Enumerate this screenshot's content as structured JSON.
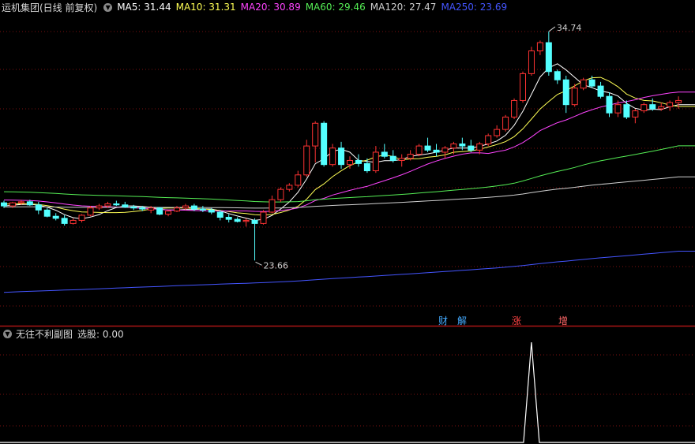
{
  "header": {
    "title": "运机集团(日线 前复权)",
    "ma": [
      {
        "label": "MA5: 31.44",
        "color": "#ffffff"
      },
      {
        "label": "MA10: 31.31",
        "color": "#ffff55"
      },
      {
        "label": "MA20: 30.89",
        "color": "#ff44ff"
      },
      {
        "label": "MA60: 29.46",
        "color": "#55ee55"
      },
      {
        "label": "MA120: 27.47",
        "color": "#d0d0d0"
      },
      {
        "label": "MA250: 23.69",
        "color": "#4455ff"
      }
    ]
  },
  "indicator": {
    "title": "无往不利副图",
    "value_text": "选股: 0.00"
  },
  "annotations": {
    "high": "34.74",
    "low": "23.66",
    "events": [
      {
        "text": "财",
        "color": "#44aaff"
      },
      {
        "text": "解",
        "color": "#44aaff"
      },
      {
        "text": "涨",
        "color": "#ff4444"
      },
      {
        "text": "增",
        "color": "#ff6666"
      }
    ]
  },
  "colors": {
    "up": "#ff3333",
    "down": "#54ffff",
    "grid": "#7a1010",
    "separator": "#aa1515",
    "ma5": "#ffffff",
    "ma10": "#ffff55",
    "ma20": "#ff44ff",
    "ma60": "#55ee55",
    "ma120": "#d0d0d0",
    "ma250": "#4455ff"
  },
  "chart_data": {
    "type": "candlestick",
    "ohlc": [
      [
        26.45,
        26.55,
        26.2,
        26.3
      ],
      [
        26.3,
        26.5,
        26.2,
        26.45
      ],
      [
        26.45,
        26.6,
        26.35,
        26.5
      ],
      [
        26.5,
        26.6,
        26.3,
        26.35
      ],
      [
        26.35,
        26.5,
        25.9,
        26.1
      ],
      [
        26.1,
        26.2,
        25.75,
        25.8
      ],
      [
        25.8,
        25.95,
        25.6,
        25.7
      ],
      [
        25.7,
        25.85,
        25.35,
        25.45
      ],
      [
        25.45,
        25.7,
        25.4,
        25.6
      ],
      [
        25.6,
        25.9,
        25.5,
        25.85
      ],
      [
        25.85,
        26.3,
        25.8,
        26.2
      ],
      [
        26.2,
        26.4,
        26.1,
        26.3
      ],
      [
        26.3,
        26.5,
        26.2,
        26.4
      ],
      [
        26.4,
        26.55,
        26.3,
        26.35
      ],
      [
        26.35,
        26.5,
        26.2,
        26.25
      ],
      [
        26.25,
        26.35,
        26.1,
        26.2
      ],
      [
        26.2,
        26.3,
        26.05,
        26.15
      ],
      [
        26.1,
        26.3,
        25.95,
        26.2
      ],
      [
        26.2,
        26.25,
        25.85,
        25.9
      ],
      [
        25.9,
        26.1,
        25.8,
        26.05
      ],
      [
        26.05,
        26.3,
        26.0,
        26.2
      ],
      [
        26.2,
        26.4,
        26.1,
        26.3
      ],
      [
        26.3,
        26.4,
        26.05,
        26.15
      ],
      [
        26.15,
        26.3,
        26.0,
        26.1
      ],
      [
        26.1,
        26.2,
        25.9,
        26.0
      ],
      [
        26.0,
        26.1,
        25.6,
        25.75
      ],
      [
        25.75,
        25.9,
        25.5,
        25.65
      ],
      [
        25.65,
        25.75,
        25.5,
        25.55
      ],
      [
        25.55,
        25.7,
        25.3,
        25.6
      ],
      [
        25.6,
        25.7,
        23.66,
        25.45
      ],
      [
        25.45,
        26.1,
        25.4,
        26.0
      ],
      [
        26.0,
        26.8,
        25.95,
        26.6
      ],
      [
        26.6,
        27.2,
        26.5,
        27.1
      ],
      [
        27.1,
        27.4,
        27.0,
        27.3
      ],
      [
        27.3,
        28.0,
        27.2,
        27.8
      ],
      [
        27.8,
        29.5,
        27.7,
        29.2
      ],
      [
        29.2,
        30.4,
        28.4,
        30.3
      ],
      [
        30.3,
        30.4,
        28.2,
        28.3
      ],
      [
        28.3,
        29.3,
        28.2,
        29.1
      ],
      [
        29.1,
        29.4,
        28.1,
        28.3
      ],
      [
        28.3,
        28.7,
        28.1,
        28.5
      ],
      [
        28.5,
        28.8,
        28.2,
        28.35
      ],
      [
        28.35,
        28.6,
        27.9,
        28.0
      ],
      [
        28.0,
        29.2,
        27.9,
        28.9
      ],
      [
        28.9,
        29.3,
        28.6,
        28.7
      ],
      [
        28.7,
        29.0,
        28.4,
        28.5
      ],
      [
        28.5,
        28.8,
        28.2,
        28.6
      ],
      [
        28.6,
        29.0,
        28.5,
        28.8
      ],
      [
        28.8,
        29.3,
        28.7,
        29.2
      ],
      [
        29.2,
        29.6,
        28.9,
        29.0
      ],
      [
        29.0,
        29.3,
        28.7,
        28.9
      ],
      [
        28.9,
        29.2,
        28.6,
        29.1
      ],
      [
        29.1,
        29.4,
        28.8,
        29.3
      ],
      [
        29.3,
        29.6,
        29.0,
        29.2
      ],
      [
        29.2,
        29.5,
        28.9,
        29.0
      ],
      [
        29.0,
        29.4,
        28.8,
        29.3
      ],
      [
        29.3,
        29.8,
        29.2,
        29.7
      ],
      [
        29.7,
        30.2,
        29.6,
        30.0
      ],
      [
        30.0,
        30.7,
        29.9,
        30.6
      ],
      [
        30.6,
        31.5,
        30.5,
        31.4
      ],
      [
        31.4,
        32.8,
        31.3,
        32.7
      ],
      [
        32.7,
        34.0,
        32.6,
        33.8
      ],
      [
        33.8,
        34.3,
        33.6,
        34.2
      ],
      [
        34.2,
        34.74,
        32.6,
        32.8
      ],
      [
        32.8,
        32.9,
        32.2,
        32.4
      ],
      [
        32.4,
        32.6,
        30.8,
        31.2
      ],
      [
        31.2,
        32.2,
        31.1,
        32.0
      ],
      [
        32.0,
        32.5,
        31.9,
        32.4
      ],
      [
        32.4,
        32.6,
        32.0,
        32.1
      ],
      [
        32.1,
        32.3,
        31.5,
        31.6
      ],
      [
        31.6,
        31.8,
        30.6,
        30.8
      ],
      [
        30.8,
        31.4,
        30.6,
        31.2
      ],
      [
        31.2,
        31.4,
        30.5,
        30.6
      ],
      [
        30.6,
        31.0,
        30.3,
        30.9
      ],
      [
        30.9,
        31.3,
        30.8,
        31.2
      ],
      [
        31.2,
        31.5,
        30.9,
        31.0
      ],
      [
        31.0,
        31.3,
        30.9,
        31.1
      ],
      [
        31.1,
        31.4,
        30.9,
        31.3
      ],
      [
        31.3,
        31.6,
        31.0,
        31.4
      ]
    ],
    "signal": [
      0,
      0,
      0,
      0,
      0,
      0,
      0,
      0,
      0,
      0,
      0,
      0,
      0,
      0,
      0,
      0,
      0,
      0,
      0,
      0,
      0,
      0,
      0,
      0,
      0,
      0,
      0,
      0,
      0,
      0,
      0,
      0,
      0,
      0,
      0,
      0,
      0,
      0,
      0,
      0,
      0,
      0,
      0,
      0,
      0,
      0,
      0,
      0,
      0,
      0,
      0,
      0,
      0,
      0,
      0,
      0,
      0,
      0,
      0,
      0,
      0,
      1,
      0,
      0,
      0,
      0,
      0,
      0,
      0,
      0,
      0,
      0,
      0,
      0,
      0,
      0,
      0,
      0,
      0
    ],
    "ma_periods": [
      5,
      10,
      20,
      60,
      120,
      250
    ],
    "ma_start_values": [
      26.3,
      26.4,
      26.6,
      27.0,
      26.25,
      22.1
    ]
  }
}
